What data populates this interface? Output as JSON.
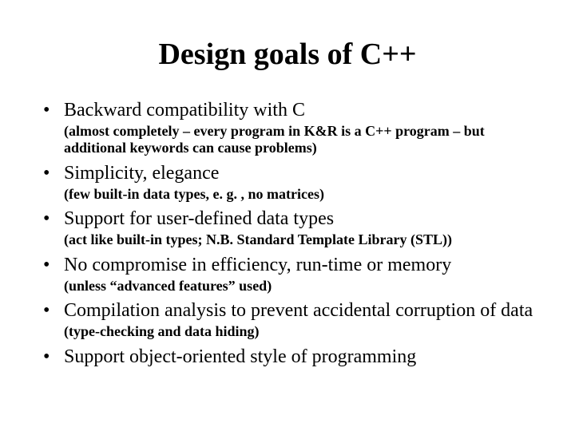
{
  "title": "Design goals of C++",
  "bullets": [
    {
      "point": "Backward compatibility with C",
      "sub": "(almost completely – every program in K&R is a C++ program – but additional keywords can cause problems)"
    },
    {
      "point": "Simplicity, elegance",
      "sub": "(few built-in data types, e. g. , no matrices)"
    },
    {
      "point": "Support for user-defined data types",
      "sub": "(act like built-in types; N.B. Standard Template Library (STL))"
    },
    {
      "point": "No compromise in efficiency, run-time or memory",
      "sub": "(unless “advanced features” used)"
    },
    {
      "point": "Compilation analysis to prevent accidental corruption of data",
      "sub": "(type-checking and data hiding)"
    },
    {
      "point": "Support object-oriented style of programming",
      "sub": ""
    }
  ]
}
